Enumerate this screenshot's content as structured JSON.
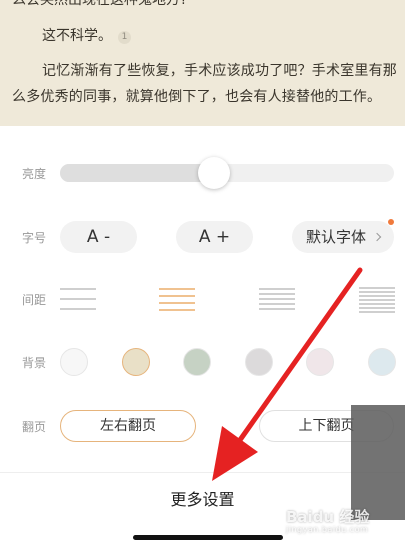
{
  "reader": {
    "cut_line": "么会突然出现在这种鬼地方?",
    "line1": "这不科学。",
    "badge": "1",
    "paragraph": "记忆渐渐有了些恢复，手术应该成功了吧？手术室里有那么多优秀的同事，就算他倒下了，也会有人接替他的工作。"
  },
  "settings": {
    "brightness_label": "亮度",
    "brightness_level": 0.46,
    "font_size_label": "字号",
    "font_decrease": "A -",
    "font_increase": "A +",
    "font_family": "默认字体",
    "spacing_label": "间距",
    "spacing_selected_index": 1,
    "background_label": "背景",
    "background_colors": [
      "#f7f7f7",
      "#e9e0c7",
      "#c6d2c4",
      "#dcdadb",
      "#f0e6e9",
      "#dde9ee"
    ],
    "background_selected_index": 1,
    "page_turn_label": "翻页",
    "page_turn_left_right": "左右翻页",
    "page_turn_up_down": "上下翻页",
    "more_settings": "更多设置"
  },
  "watermark": {
    "brand": "Baidu 经验",
    "sub": "jingyan.baidu.com"
  },
  "colors": {
    "reader_bg": "#efe9d9",
    "accent": "#e6b47c",
    "notice_dot": "#f07a3c",
    "annotation_arrow": "#e52222"
  }
}
